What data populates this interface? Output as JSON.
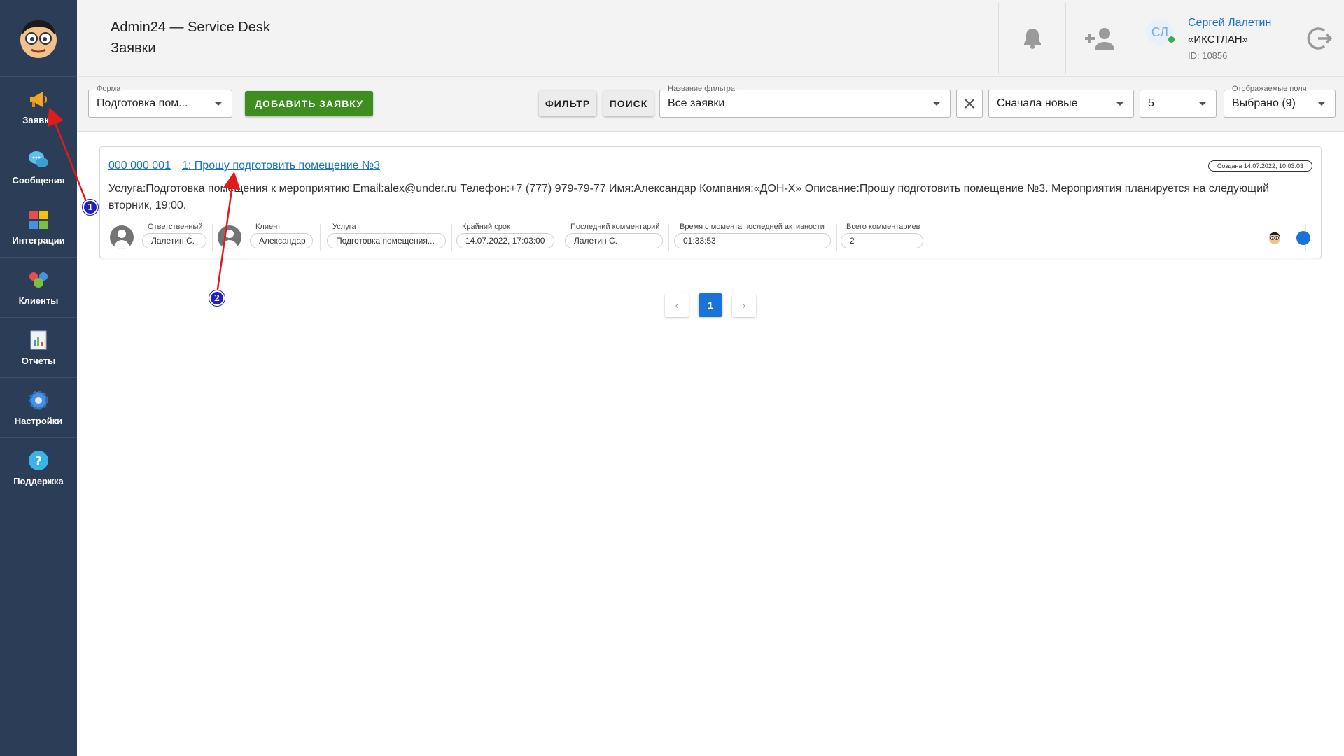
{
  "colors": {
    "sidebar": "#2b3d57",
    "accent": "#1a73d9",
    "add_button": "#3e8e1f",
    "link": "#1a73c9"
  },
  "sidebar": {
    "items": [
      {
        "label": "Заявки",
        "icon": "megaphone-icon"
      },
      {
        "label": "Сообщения",
        "icon": "chat-bubbles-icon"
      },
      {
        "label": "Интеграции",
        "icon": "puzzle-icon"
      },
      {
        "label": "Клиенты",
        "icon": "users-icon"
      },
      {
        "label": "Отчеты",
        "icon": "report-chart-icon"
      },
      {
        "label": "Настройки",
        "icon": "gear-icon"
      },
      {
        "label": "Поддержка",
        "icon": "question-icon"
      }
    ]
  },
  "header": {
    "app_title": "Admin24 — Service Desk",
    "page_title": "Заявки",
    "user": {
      "initials": "СЛ",
      "name": "Сергей Лалетин",
      "company": "«ИКСТЛАН»",
      "id": "ID: 10856"
    }
  },
  "toolbar": {
    "form": {
      "legend": "Форма",
      "value": "Подготовка пом..."
    },
    "add_label": "ДОБАВИТЬ ЗАЯВКУ",
    "filter_label": "ФИЛЬТР",
    "search_label": "ПОИСК",
    "filter_name": {
      "legend": "Название фильтра",
      "value": "Все заявки"
    },
    "sort": {
      "value": "Сначала новые"
    },
    "per_page": {
      "value": "5"
    },
    "fields": {
      "legend": "Отображаемые поля",
      "value": "Выбрано (9)"
    }
  },
  "ticket": {
    "number": "000 000 001",
    "title": "1: Прошу подготовить помещение №3",
    "created": "Создана 14.07.2022, 10:03:03",
    "description": "Услуга:Подготовка помещения к мероприятию Email:alex@under.ru Телефон:+7 (777) 979-79-77 Имя:Александар Компания:«ДОН-Х» Описание:Прошу подготовить помещение №3. Мероприятия планируется на следующий вторник, 19:00.",
    "meta": {
      "responsible": {
        "label": "Ответственный",
        "value": "Лалетин С."
      },
      "client": {
        "label": "Клиент",
        "value": "Александар"
      },
      "service": {
        "label": "Услуга",
        "value": "Подготовка помещения..."
      },
      "deadline": {
        "label": "Крайний срок",
        "value": "14.07.2022, 17:03:00"
      },
      "last_comment": {
        "label": "Последний комментарий",
        "value": "Лалетин С."
      },
      "since_activity": {
        "label": "Время с момента последней активности",
        "value": "01:33:53"
      },
      "total_comments": {
        "label": "Всего комментариев",
        "value": "2"
      }
    }
  },
  "pagination": {
    "prev": "‹",
    "current": "1",
    "next": "›"
  },
  "annotations": {
    "marker1": "1",
    "marker2": "2"
  }
}
